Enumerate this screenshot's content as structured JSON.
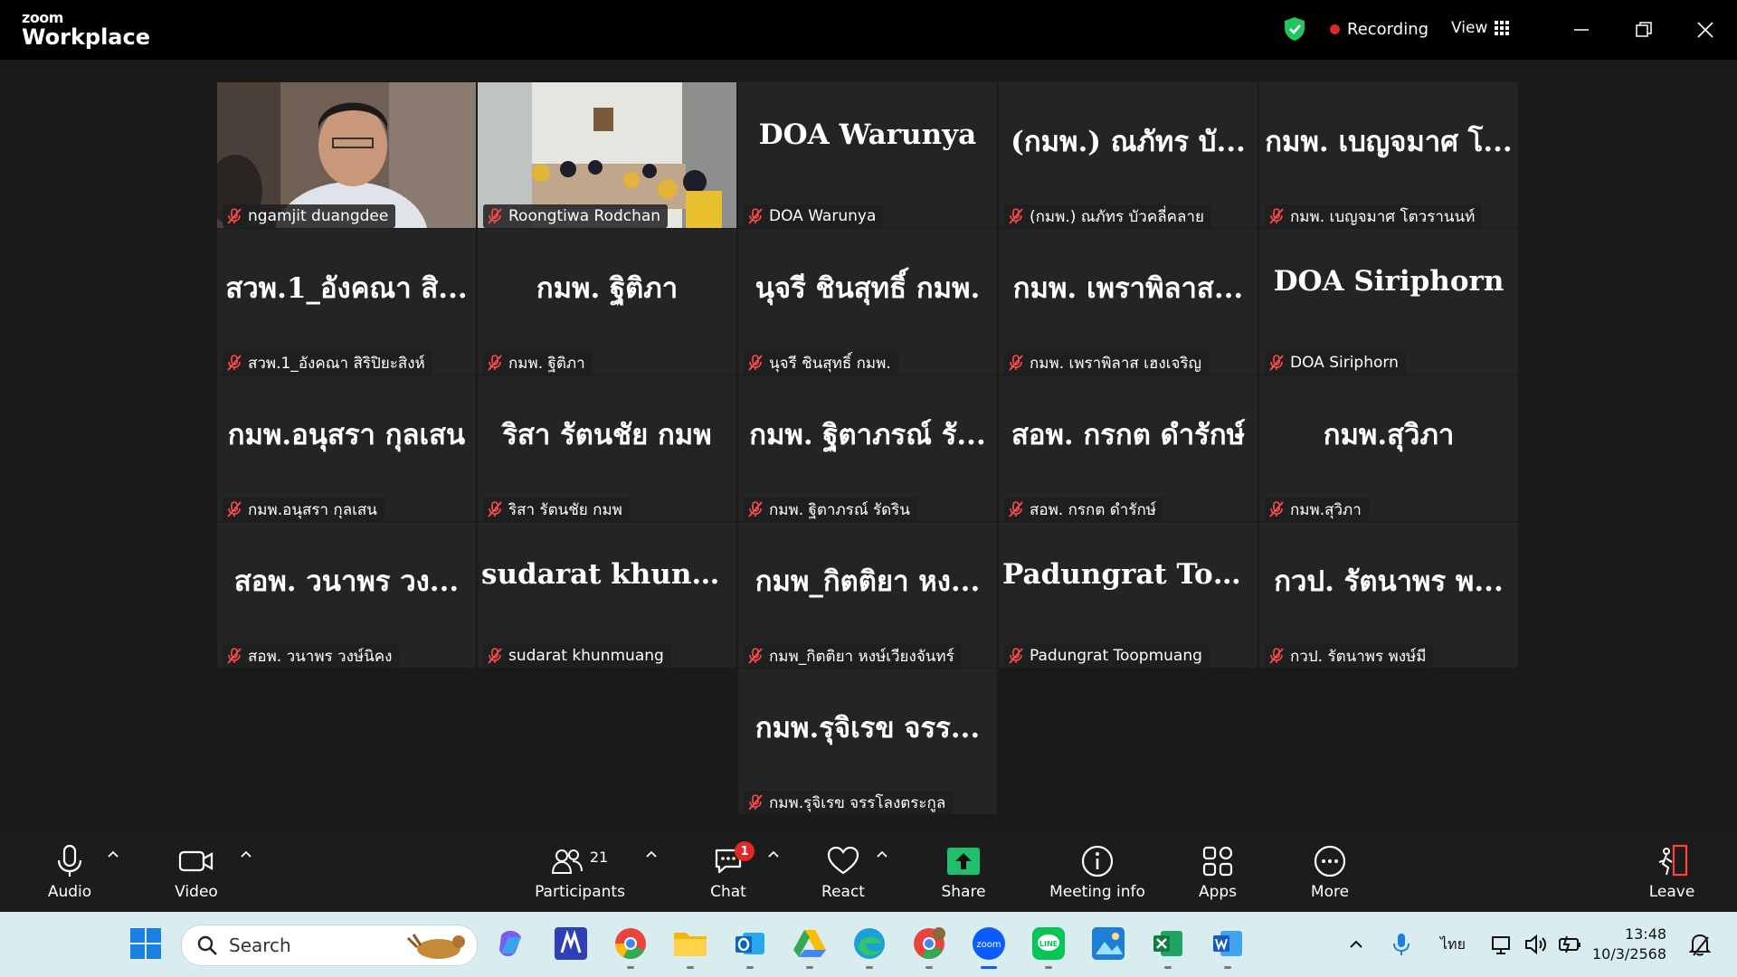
{
  "window": {
    "logo_line1": "zoom",
    "logo_line2": "Workplace",
    "recording_label": "Recording",
    "view_label": "View"
  },
  "tiles": [
    {
      "label": "ngamjit duangdee",
      "big": "",
      "video": "person"
    },
    {
      "label": "Roongtiwa Rodchan",
      "big": "",
      "video": "room",
      "active": true
    },
    {
      "label": "DOA Warunya",
      "big": "DOA Warunya"
    },
    {
      "label": "(กมพ.) ณภัทร บัวคลี่คลาย",
      "big": "(กมพ.) ณภัทร บั..."
    },
    {
      "label": "กมพ. เบญจมาศ โตวรานนท์",
      "big": "กมพ. เบญจมาศ โ..."
    },
    {
      "label": "สวพ.1_อังคณา สิริปิยะสิงห์",
      "big": "สวพ.1_อังคณา สิ..."
    },
    {
      "label": "กมพ. ฐิติภา",
      "big": "กมพ. ฐิติภา"
    },
    {
      "label": "นุจรี ชินสุทธิ์ กมพ.",
      "big": "นุจรี ชินสุทธิ์ กมพ."
    },
    {
      "label": "กมพ. เพราพิลาส เฮงเจริญ",
      "big": "กมพ. เพราพิลาส..."
    },
    {
      "label": "DOA Siriphorn",
      "big": "DOA Siriphorn"
    },
    {
      "label": "กมพ.อนุสรา กุลเสน",
      "big": "กมพ.อนุสรา กุลเสน"
    },
    {
      "label": "ริสา รัตนชัย กมพ",
      "big": "ริสา รัตนชัย กมพ"
    },
    {
      "label": "กมพ. ฐิตาภรณ์ รัดริน",
      "big": "กมพ. ฐิตาภรณ์ รั..."
    },
    {
      "label": "สอพ. กรกต ดำรักษ์",
      "big": "สอพ. กรกต ดำรักษ์"
    },
    {
      "label": "กมพ.สุวิภา",
      "big": "กมพ.สุวิภา"
    },
    {
      "label": "สอพ. วนาพร วงษ์นิคง",
      "big": "สอพ. วนาพร วง..."
    },
    {
      "label": "sudarat khunmuang",
      "big": "sudarat khunm..."
    },
    {
      "label": "กมพ_กิตติยา หงษ์เวียงจันทร์",
      "big": "กมพ_กิตติยา หง..."
    },
    {
      "label": "Padungrat Toopmuang",
      "big": "Padungrat Toop..."
    },
    {
      "label": "กวป. รัตนาพร พงษ์มี",
      "big": "กวป. รัตนาพร พ..."
    },
    {
      "label": "กมพ.รุจิเรข จรรโลงตระกูล",
      "big": "กมพ.รุจิเรข จรร..."
    }
  ],
  "toolbar": {
    "audio": "Audio",
    "video": "Video",
    "participants": "Participants",
    "participants_count": "21",
    "chat": "Chat",
    "chat_badge": "1",
    "react": "React",
    "share": "Share",
    "meeting_info": "Meeting info",
    "apps": "Apps",
    "more": "More",
    "leave": "Leave"
  },
  "taskbar": {
    "search_placeholder": "Search",
    "language": "ไทย",
    "time": "13:48",
    "date": "10/3/2568"
  },
  "colors": {
    "active_speaker": "#23d97b",
    "recording_dot": "#e02828",
    "share_button": "#1fbf6b"
  }
}
